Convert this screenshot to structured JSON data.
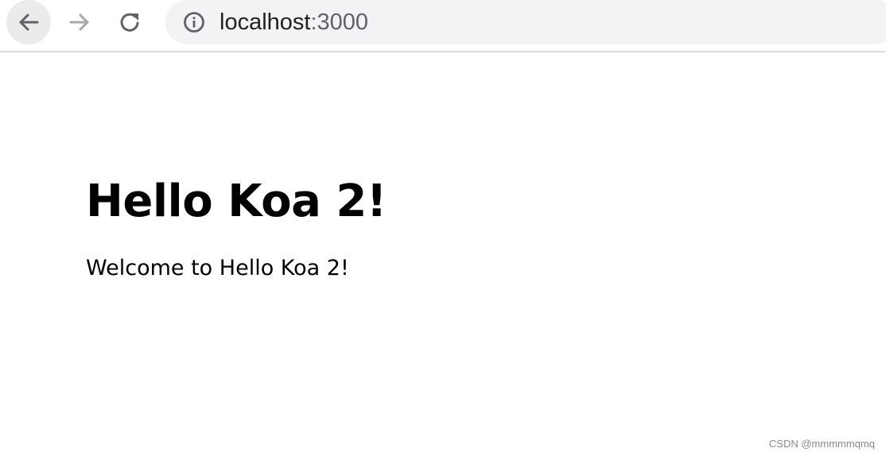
{
  "browser": {
    "address": {
      "host": "localhost",
      "port": ":3000"
    },
    "icons": {
      "back": "arrow-left-icon",
      "forward": "arrow-right-icon",
      "reload": "reload-icon",
      "site_info": "info-icon"
    },
    "colors": {
      "toolbar_bg": "#ffffff",
      "omnibox_bg": "#f1f3f4",
      "icon_active": "#5f6368",
      "icon_disabled": "#a8a8a8"
    }
  },
  "page": {
    "heading": "Hello Koa 2!",
    "body_text": "Welcome to Hello Koa 2!"
  },
  "watermark": "CSDN @mmmmmqmq"
}
